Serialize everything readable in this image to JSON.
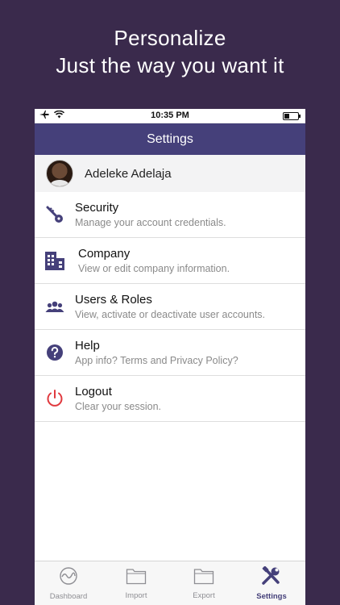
{
  "promo": {
    "line1": "Personalize",
    "line2": "Just the way you want it"
  },
  "status_bar": {
    "time": "10:35 PM",
    "battery_level": 0.35
  },
  "nav": {
    "title": "Settings"
  },
  "profile": {
    "name": "Adeleke Adelaja"
  },
  "menu": [
    {
      "title": "Security",
      "subtitle": "Manage your account credentials.",
      "icon": "key-icon"
    },
    {
      "title": "Company",
      "subtitle": "View or edit company information.",
      "icon": "building-icon"
    },
    {
      "title": "Users & Roles",
      "subtitle": "View, activate or deactivate user accounts.",
      "icon": "users-icon"
    },
    {
      "title": "Help",
      "subtitle": "App info? Terms and Privacy Policy?",
      "icon": "help-icon"
    },
    {
      "title": "Logout",
      "subtitle": "Clear your session.",
      "icon": "power-icon"
    }
  ],
  "tabs": [
    {
      "label": "Dashboard",
      "icon": "dashboard-icon",
      "active": false
    },
    {
      "label": "Import",
      "icon": "folder-icon",
      "active": false
    },
    {
      "label": "Export",
      "icon": "folder-icon",
      "active": false
    },
    {
      "label": "Settings",
      "icon": "tools-icon",
      "active": true
    }
  ],
  "colors": {
    "background": "#3a2a4c",
    "navbar": "#45407a",
    "accent": "#45407a",
    "logout_red": "#e0393e"
  }
}
